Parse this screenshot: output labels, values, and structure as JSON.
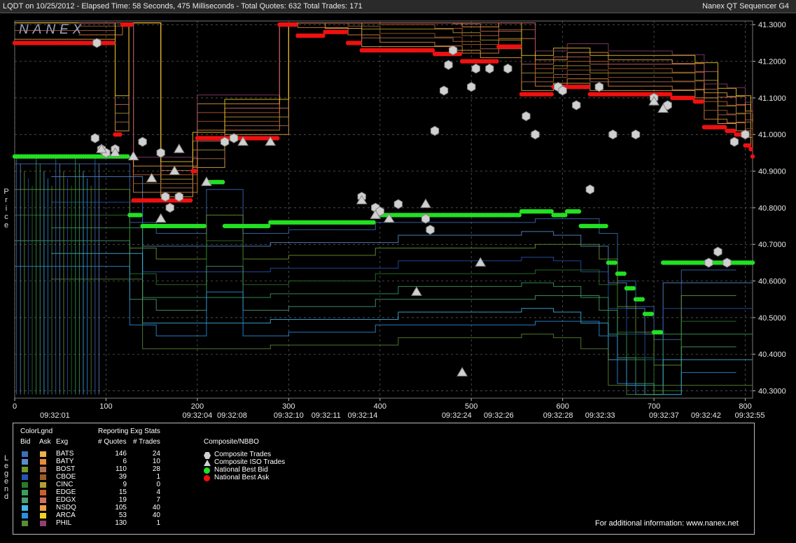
{
  "header": {
    "left": "LQDT on 10/25/2012  -  Elapsed Time: 58 Seconds, 475 Milliseconds  -  Total Quotes: 632  Total Trades: 171",
    "right": "Nanex QT Sequencer G4"
  },
  "logo_text": "NANEX",
  "side_labels": {
    "price": "Price",
    "legend": "Legend"
  },
  "chart_data": {
    "type": "scatter",
    "title": "",
    "y_ticks": [
      "41.3000",
      "41.2000",
      "41.1000",
      "41.0000",
      "40.9000",
      "40.8000",
      "40.7000",
      "40.6000",
      "40.5000",
      "40.4000",
      "40.3000"
    ],
    "ylim": [
      40.28,
      41.31
    ],
    "xlim": [
      0,
      808
    ],
    "x_ticks": [
      0,
      100,
      200,
      300,
      400,
      500,
      600,
      700,
      800
    ],
    "time_labels": [
      {
        "x": 44,
        "label": "09:32:01"
      },
      {
        "x": 200,
        "label": "09:32:04"
      },
      {
        "x": 238,
        "label": "09:32:08"
      },
      {
        "x": 300,
        "label": "09:32:10"
      },
      {
        "x": 341,
        "label": "09:32:11"
      },
      {
        "x": 381,
        "label": "09:32:14"
      },
      {
        "x": 484,
        "label": "09:32:24"
      },
      {
        "x": 530,
        "label": "09:32:26"
      },
      {
        "x": 595,
        "label": "09:32:28"
      },
      {
        "x": 641,
        "label": "09:32:33"
      },
      {
        "x": 711,
        "label": "09:32:37"
      },
      {
        "x": 757,
        "label": "09:32:42"
      },
      {
        "x": 805,
        "label": "09:32:55"
      }
    ],
    "best_bid": [
      [
        0,
        40.94
      ],
      [
        40,
        40.94
      ],
      [
        80,
        40.94
      ],
      [
        100,
        40.94
      ],
      [
        126,
        40.78
      ],
      [
        140,
        40.75
      ],
      [
        155,
        40.75
      ],
      [
        175,
        40.75
      ],
      [
        190,
        40.75
      ],
      [
        205,
        40.75
      ],
      [
        210,
        40.87
      ],
      [
        230,
        40.75
      ],
      [
        250,
        40.75
      ],
      [
        280,
        40.76
      ],
      [
        300,
        40.76
      ],
      [
        330,
        40.76
      ],
      [
        360,
        40.76
      ],
      [
        380,
        40.76
      ],
      [
        395,
        40.78
      ],
      [
        420,
        40.78
      ],
      [
        440,
        40.78
      ],
      [
        470,
        40.78
      ],
      [
        500,
        40.78
      ],
      [
        520,
        40.78
      ],
      [
        545,
        40.78
      ],
      [
        555,
        40.79
      ],
      [
        570,
        40.79
      ],
      [
        590,
        40.78
      ],
      [
        605,
        40.79
      ],
      [
        620,
        40.75
      ],
      [
        640,
        40.75
      ],
      [
        650,
        40.65
      ],
      [
        660,
        40.62
      ],
      [
        670,
        40.58
      ],
      [
        680,
        40.55
      ],
      [
        690,
        40.51
      ],
      [
        700,
        40.46
      ],
      [
        710,
        40.65
      ],
      [
        730,
        40.65
      ],
      [
        760,
        40.65
      ],
      [
        790,
        40.65
      ],
      [
        808,
        40.65
      ]
    ],
    "best_ask": [
      [
        0,
        41.25
      ],
      [
        70,
        41.25
      ],
      [
        110,
        41.0
      ],
      [
        118,
        41.3
      ],
      [
        125,
        41.3
      ],
      [
        130,
        40.82
      ],
      [
        160,
        40.82
      ],
      [
        190,
        40.82
      ],
      [
        195,
        40.9
      ],
      [
        200,
        40.99
      ],
      [
        230,
        40.99
      ],
      [
        260,
        40.99
      ],
      [
        278,
        40.99
      ],
      [
        290,
        41.3
      ],
      [
        300,
        41.3
      ],
      [
        310,
        41.27
      ],
      [
        340,
        41.28
      ],
      [
        365,
        41.25
      ],
      [
        380,
        41.23
      ],
      [
        400,
        41.23
      ],
      [
        430,
        41.23
      ],
      [
        460,
        41.22
      ],
      [
        480,
        41.22
      ],
      [
        490,
        41.2
      ],
      [
        510,
        41.2
      ],
      [
        530,
        41.24
      ],
      [
        555,
        41.11
      ],
      [
        570,
        41.11
      ],
      [
        590,
        41.13
      ],
      [
        605,
        41.13
      ],
      [
        630,
        41.11
      ],
      [
        650,
        41.11
      ],
      [
        700,
        41.11
      ],
      [
        720,
        41.1
      ],
      [
        745,
        41.09
      ],
      [
        755,
        41.02
      ],
      [
        770,
        41.02
      ],
      [
        780,
        41.01
      ],
      [
        790,
        41.0
      ],
      [
        800,
        40.97
      ],
      [
        806,
        40.96
      ],
      [
        808,
        40.94
      ]
    ],
    "trades": [
      [
        88,
        40.99
      ],
      [
        90,
        41.25
      ],
      [
        95,
        40.96
      ],
      [
        100,
        40.95
      ],
      [
        110,
        40.96
      ],
      [
        140,
        40.98
      ],
      [
        160,
        40.95
      ],
      [
        165,
        40.83
      ],
      [
        170,
        40.8
      ],
      [
        180,
        40.83
      ],
      [
        230,
        40.98
      ],
      [
        240,
        40.99
      ],
      [
        380,
        40.83
      ],
      [
        395,
        40.8
      ],
      [
        400,
        40.79
      ],
      [
        420,
        40.81
      ],
      [
        450,
        40.77
      ],
      [
        455,
        40.74
      ],
      [
        460,
        41.01
      ],
      [
        470,
        41.12
      ],
      [
        475,
        41.19
      ],
      [
        480,
        41.23
      ],
      [
        500,
        41.13
      ],
      [
        505,
        41.18
      ],
      [
        520,
        41.18
      ],
      [
        540,
        41.18
      ],
      [
        560,
        41.05
      ],
      [
        570,
        41.0
      ],
      [
        595,
        41.13
      ],
      [
        600,
        41.12
      ],
      [
        615,
        41.08
      ],
      [
        630,
        40.85
      ],
      [
        640,
        41.13
      ],
      [
        655,
        41.0
      ],
      [
        680,
        41.0
      ],
      [
        700,
        41.1
      ],
      [
        715,
        41.08
      ],
      [
        760,
        40.65
      ],
      [
        770,
        40.68
      ],
      [
        780,
        40.65
      ],
      [
        788,
        40.98
      ],
      [
        800,
        41.0
      ]
    ],
    "iso_trades": [
      [
        95,
        40.96
      ],
      [
        110,
        40.95
      ],
      [
        130,
        40.94
      ],
      [
        150,
        40.88
      ],
      [
        160,
        40.77
      ],
      [
        175,
        40.9
      ],
      [
        180,
        40.96
      ],
      [
        210,
        40.87
      ],
      [
        250,
        40.98
      ],
      [
        280,
        40.98
      ],
      [
        380,
        40.82
      ],
      [
        395,
        40.78
      ],
      [
        410,
        40.77
      ],
      [
        440,
        40.57
      ],
      [
        450,
        40.81
      ],
      [
        490,
        40.35
      ],
      [
        510,
        40.65
      ],
      [
        700,
        41.09
      ],
      [
        710,
        41.07
      ]
    ]
  },
  "legend": {
    "colorlgnd_title": "ColorLgnd",
    "stats_title": "Reporting Exg Stats",
    "col_bid": "Bid",
    "col_ask": "Ask",
    "col_exg": "Exg",
    "col_quotes": "# Quotes",
    "col_trades": "# Trades",
    "composite_title": "Composite/NBBO",
    "rows": [
      {
        "exg": "BATS",
        "quotes": "146",
        "trades": "24",
        "bid": "#3d6fb8",
        "ask": "#f0b048"
      },
      {
        "exg": "BATY",
        "quotes": "6",
        "trades": "10",
        "bid": "#5a8ed0",
        "ask": "#e88b3a"
      },
      {
        "exg": "BOST",
        "quotes": "110",
        "trades": "28",
        "bid": "#6b9a2e",
        "ask": "#b07050"
      },
      {
        "exg": "CBOE",
        "quotes": "39",
        "trades": "1",
        "bid": "#2455b0",
        "ask": "#a05c28"
      },
      {
        "exg": "CINC",
        "quotes": "9",
        "trades": "0",
        "bid": "#2a7a2a",
        "ask": "#b0a030"
      },
      {
        "exg": "EDGE",
        "quotes": "15",
        "trades": "4",
        "bid": "#3aa060",
        "ask": "#c86030"
      },
      {
        "exg": "EDGX",
        "quotes": "19",
        "trades": "7",
        "bid": "#4aa070",
        "ask": "#d07060"
      },
      {
        "exg": "NSDQ",
        "quotes": "105",
        "trades": "40",
        "bid": "#40b8e8",
        "ask": "#f0a040"
      },
      {
        "exg": "ARCA",
        "quotes": "53",
        "trades": "40",
        "bid": "#2a90e0",
        "ask": "#f0d020"
      },
      {
        "exg": "PHIL",
        "quotes": "130",
        "trades": "1",
        "bid": "#5a8a3a",
        "ask": "#904070"
      }
    ],
    "composite": [
      {
        "symbol": "hexagon",
        "label": "Composite Trades",
        "color": "#d0d0d0"
      },
      {
        "symbol": "triangle",
        "label": "Composite ISO Trades",
        "color": "#d0d0d0"
      },
      {
        "symbol": "circle",
        "label": "National Best Bid",
        "color": "#22e022"
      },
      {
        "symbol": "circle",
        "label": "National Best Ask",
        "color": "#ee1111"
      }
    ]
  },
  "footer": "For additional information: www.nanex.net"
}
